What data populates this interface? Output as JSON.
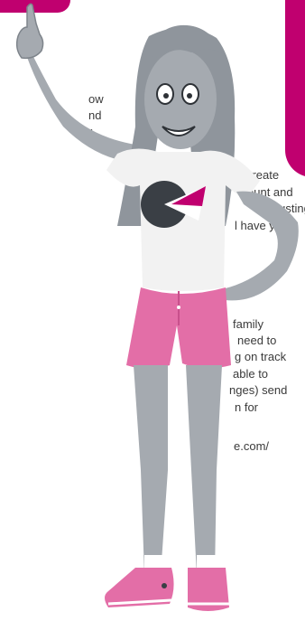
{
  "colors": {
    "accent": "#c0006f",
    "pink": "#e36ea7",
    "grey": "#a5aab0",
    "dark": "#3a3f45"
  },
  "text_lines": [
    "ow",
    "nd",
    "r",
    "int, create",
    "ount and",
    "rb-busting",
    "l have you",
    "family",
    "need to",
    "g on track",
    "able to",
    "nges) send",
    "n for",
    "e.com/"
  ],
  "illustration": {
    "name": "girl-character-pointing-up",
    "shirt_logo": "pie-logo-icon"
  }
}
